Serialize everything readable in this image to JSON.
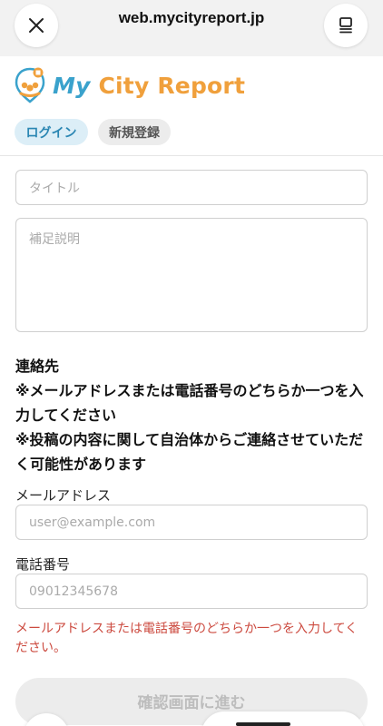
{
  "browser": {
    "url": "web.mycityreport.jp",
    "close_icon": "close-icon",
    "tabs_icon": "tabs-icon"
  },
  "header": {
    "logo_text_my": "My",
    "logo_text_rest": "City Report",
    "login_label": "ログイン",
    "register_label": "新規登録"
  },
  "form": {
    "title_placeholder": "タイトル",
    "description_placeholder": "補足説明",
    "contact_heading": "連絡先",
    "contact_note_1": "※メールアドレスまたは電話番号のどちらか一つを入力してください",
    "contact_note_2": "※投稿の内容に関して自治体からご連絡させていただく可能性があります",
    "email_label": "メールアドレス",
    "email_placeholder": "user@example.com",
    "phone_label": "電話番号",
    "phone_placeholder": "09012345678",
    "error_message": "メールアドレスまたは電話番号のどちらか一つを入力してください。",
    "confirm_label": "確認画面に進む"
  },
  "colors": {
    "accent_blue": "#3aa2cc",
    "accent_orange": "#f0a03c",
    "error_red": "#cc4a3f"
  }
}
